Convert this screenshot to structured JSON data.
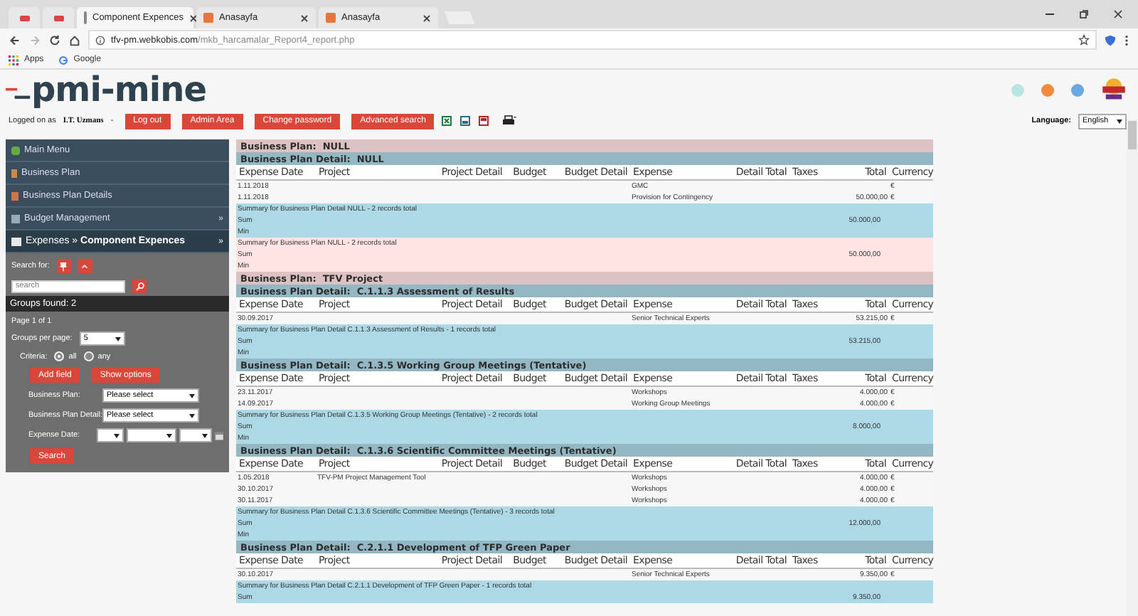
{
  "browser": {
    "tabs": [
      {
        "label": "Component Expences",
        "selected": true
      },
      {
        "label": "Anasayfa",
        "selected": false
      },
      {
        "label": "Anasayfa",
        "selected": false
      }
    ],
    "url_host": "tfv-pm.webkobis.com",
    "url_path": "/mkb_harcamalar_Report4_report.php",
    "bookmarks": [
      "Apps",
      "Google"
    ]
  },
  "header": {
    "logo": "pmi-mine",
    "logged_label": "Logged on as",
    "user": "I.T. Uzmans",
    "separator": "-",
    "buttons": [
      "Log out",
      "Admin Area",
      "Change password",
      "Advanced search"
    ],
    "language_label": "Language:",
    "language": "English"
  },
  "sidebar": {
    "menu": [
      {
        "label": "Main Menu",
        "selected": false
      },
      {
        "label": "Business Plan",
        "selected": false
      },
      {
        "label": "Business Plan Details",
        "selected": false
      },
      {
        "label": "Budget Management",
        "more": "»",
        "selected": false
      },
      {
        "label": "Expenses » **Component Expences**",
        "more": "»",
        "selected": true
      }
    ],
    "search_label": "Search for:",
    "search_placeholder": "search",
    "groups_found": "Groups found: 2",
    "page": "Page 1 of 1",
    "groups_per_page_label": "Groups per page:",
    "groups_per_page": "5",
    "criteria_label": "Criteria:",
    "criteria": [
      {
        "label": "all",
        "selected": true
      },
      {
        "label": "any",
        "selected": false
      }
    ],
    "action_buttons": [
      "Add field",
      "Show options"
    ],
    "filters": [
      {
        "label": "Business Plan:",
        "kind": "select",
        "value": "Please select"
      },
      {
        "label": "Business Plan Detail:",
        "kind": "select",
        "value": "Please select"
      },
      {
        "label": "Expense Date:",
        "kind": "date"
      }
    ],
    "submit": "Search"
  },
  "report": {
    "blocks": [
      {
        "kind": "plan",
        "title": "Business Plan:  NULL"
      },
      {
        "kind": "detail",
        "title": "Business Plan Detail:  NULL"
      },
      {
        "kind": "columns",
        "columns": [
          "Expense Date",
          "Project",
          "Project Detail",
          "Budget",
          "Budget Detail",
          "Expense",
          "Detail Total",
          "Taxes",
          "Total",
          "Currency"
        ]
      },
      {
        "kind": "row",
        "date": "1.11.2018",
        "expense": "GMC",
        "currency": "€"
      },
      {
        "kind": "row",
        "date": "1.11.2018",
        "expense": "Provision for Contingency",
        "total": "50.000,00",
        "currency": "€"
      },
      {
        "kind": "detail_summary",
        "title": "Summary for Business Plan Detail NULL - 2 records total",
        "sum_label": "Sum",
        "sum": "50.000,00",
        "min_label": "Min"
      },
      {
        "kind": "plan_summary",
        "title": "Summary for Business Plan NULL - 2 records total",
        "sum_label": "Sum",
        "sum": "50.000,00",
        "min_label": "Min"
      },
      {
        "kind": "plan",
        "title": "Business Plan:  TFV Project"
      },
      {
        "kind": "detail",
        "title": "Business Plan Detail:  C.1.1.3 Assessment of Results"
      },
      {
        "kind": "columns",
        "columns": [
          "Expense Date",
          "Project",
          "Project Detail",
          "Budget",
          "Budget Detail",
          "Expense",
          "Detail Total",
          "Taxes",
          "Total",
          "Currency"
        ]
      },
      {
        "kind": "row",
        "date": "30.09.2017",
        "expense": "Senior Technical Experts",
        "total": "53.215,00",
        "currency": "€"
      },
      {
        "kind": "detail_summary",
        "title": "Summary for Business Plan Detail C.1.1.3 Assessment of Results - 1 records total",
        "sum_label": "Sum",
        "sum": "53.215,00",
        "min_label": "Min"
      },
      {
        "kind": "detail",
        "title": "Business Plan Detail:  C.1.3.5 Working Group Meetings (Tentative)"
      },
      {
        "kind": "columns",
        "columns": [
          "Expense Date",
          "Project",
          "Project Detail",
          "Budget",
          "Budget Detail",
          "Expense",
          "Detail Total",
          "Taxes",
          "Total",
          "Currency"
        ]
      },
      {
        "kind": "row",
        "date": "23.11.2017",
        "expense": "Workshops",
        "total": "4.000,00",
        "currency": "€"
      },
      {
        "kind": "row",
        "date": "14.09.2017",
        "expense": "Working Group Meetings",
        "total": "4.000,00",
        "currency": "€"
      },
      {
        "kind": "detail_summary",
        "title": "Summary for Business Plan Detail C.1.3.5 Working Group Meetings (Tentative) - 2 records total",
        "sum_label": "Sum",
        "sum": "8.000,00",
        "min_label": "Min"
      },
      {
        "kind": "detail",
        "title": "Business Plan Detail:  C.1.3.6 Scientific Committee Meetings (Tentative)"
      },
      {
        "kind": "columns",
        "columns": [
          "Expense Date",
          "Project",
          "Project Detail",
          "Budget",
          "Budget Detail",
          "Expense",
          "Detail Total",
          "Taxes",
          "Total",
          "Currency"
        ]
      },
      {
        "kind": "row",
        "date": "1.05.2018",
        "project": "TFV-PM Project Management Tool",
        "expense": "Workshops",
        "total": "4.000,00",
        "currency": "€"
      },
      {
        "kind": "row",
        "date": "30.10.2017",
        "expense": "Workshops",
        "total": "4.000,00",
        "currency": "€"
      },
      {
        "kind": "row",
        "date": "30.11.2017",
        "expense": "Workshops",
        "total": "4.000,00",
        "currency": "€"
      },
      {
        "kind": "detail_summary",
        "title": "Summary for Business Plan Detail C.1.3.6 Scientific Committee Meetings (Tentative) - 3 records total",
        "sum_label": "Sum",
        "sum": "12.000,00",
        "min_label": "Min"
      },
      {
        "kind": "detail",
        "title": "Business Plan Detail:  C.2.1.1 Development of TFP Green Paper"
      },
      {
        "kind": "columns",
        "columns": [
          "Expense Date",
          "Project",
          "Project Detail",
          "Budget",
          "Budget Detail",
          "Expense",
          "Detail Total",
          "Taxes",
          "Total",
          "Currency"
        ]
      },
      {
        "kind": "row",
        "date": "30.10.2017",
        "expense": "Senior Technical Experts",
        "total": "9.350,00",
        "currency": "€"
      },
      {
        "kind": "detail_summary",
        "title": "Summary for Business Plan Detail C.2.1.1 Development of TFP Green Paper - 1 records total",
        "sum_label": "Sum",
        "sum": "9.350,00"
      }
    ]
  }
}
